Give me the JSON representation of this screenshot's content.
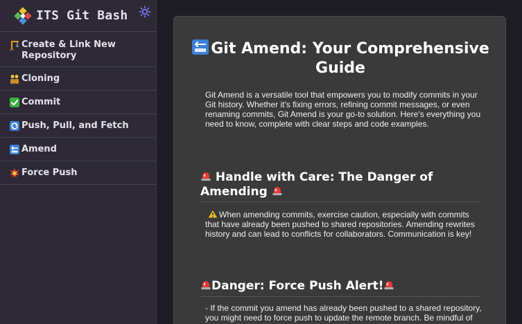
{
  "app": {
    "title": "ITS Git Bash"
  },
  "sidebar": {
    "items": [
      {
        "icon": "crane-icon",
        "label": "Create & Link New Repository"
      },
      {
        "icon": "people-icon",
        "label": "Cloning"
      },
      {
        "icon": "checkmark-icon",
        "label": "Commit"
      },
      {
        "icon": "arrows-cycle-icon",
        "label": "Push, Pull, and Fetch"
      },
      {
        "icon": "back-arrow-icon",
        "label": "Amend"
      },
      {
        "icon": "collision-icon",
        "label": "Force Push"
      }
    ]
  },
  "main": {
    "title": "Git Amend: Your Comprehensive Guide",
    "intro": "Git Amend is a versatile tool that empowers you to modify commits in your Git history. Whether it's fixing errors, refining commit messages, or even renaming commits, Git Amend is your go-to solution. Here's everything you need to know, complete with clear steps and code examples.",
    "sections": [
      {
        "heading": "Handle with Care: The Danger of Amending",
        "body": "When amending commits, exercise caution, especially with commits that have already been pushed to shared repositories. Amending rewrites history and can lead to conflicts for collaborators. Communication is key!"
      },
      {
        "heading": "Danger: Force Push Alert!",
        "body": "- If the commit you amend has already been pushed to a shared repository, you might need to force push to update the remote branch. Be mindful of potential conflicts."
      }
    ]
  },
  "colors": {
    "sidebar_bg": "#2d2a36",
    "page_bg": "#1f1d24",
    "card_bg": "#3a3a3a",
    "theme_icon": "#7d7bff"
  }
}
